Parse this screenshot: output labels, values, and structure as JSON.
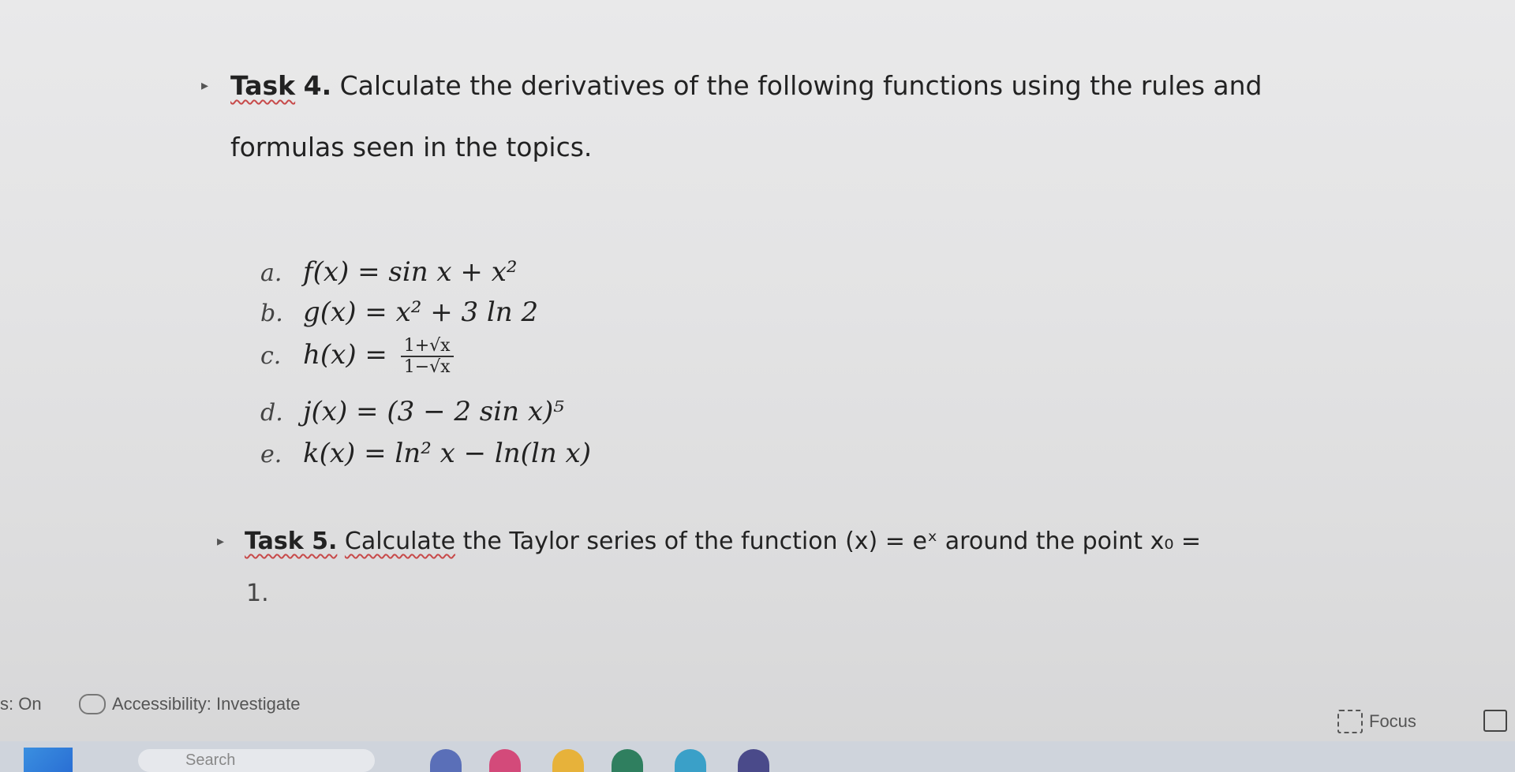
{
  "task4": {
    "label": "Task",
    "number": "4.",
    "line1_rest": " Calculate the derivatives of the following functions using the rules and",
    "line2": "formulas seen in the topics.",
    "items": [
      {
        "letter": "a.",
        "lhs": "f(x) = ",
        "body": "sin x + x²"
      },
      {
        "letter": "b.",
        "lhs": "g(x) = ",
        "body": "x² + 3 ln 2"
      },
      {
        "letter": "c.",
        "lhs": "h(x) = ",
        "numerator": "1+√x",
        "denominator": "1−√x"
      },
      {
        "letter": "d.",
        "lhs": "j(x) = ",
        "body": "(3 − 2 sin x)⁵"
      },
      {
        "letter": "e.",
        "lhs": "k(x) = ",
        "body": "ln² x − ln(ln x)"
      }
    ]
  },
  "task5": {
    "label": "Task 5.",
    "calc": "Calculate",
    "line1_rest": " the Taylor series of the function (x) = eˣ around the point x₀ =",
    "line2": "1."
  },
  "statusbar": {
    "left": "s: On",
    "accessibility": "Accessibility: Investigate",
    "focus": "Focus"
  },
  "taskbar": {
    "search_placeholder": "Search"
  }
}
